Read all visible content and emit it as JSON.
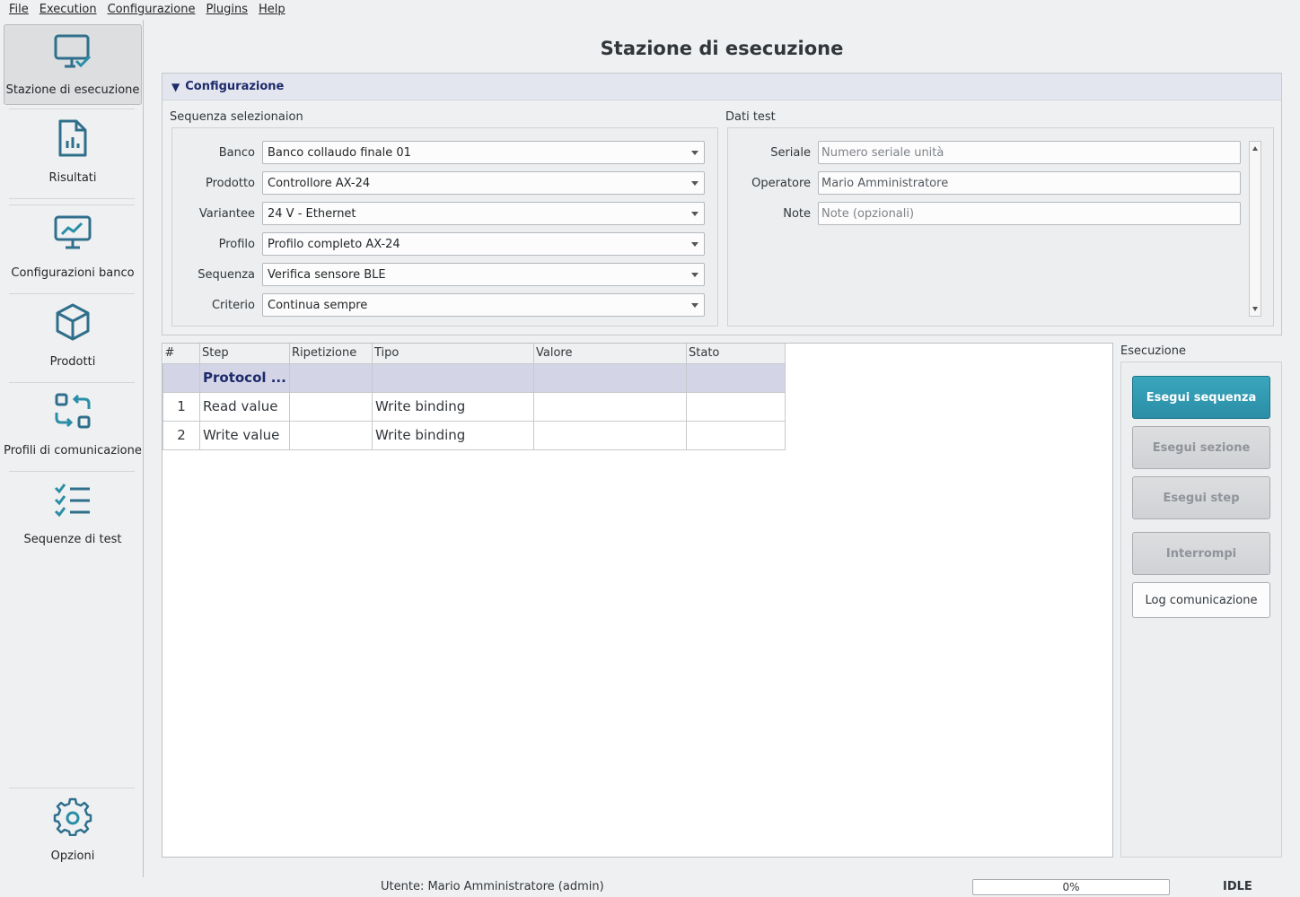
{
  "menu": [
    "File",
    "Execution",
    "Configurazione",
    "Plugins",
    "Help"
  ],
  "sidebar": {
    "items": [
      {
        "label": "Stazione di esecuzione",
        "icon": "monitor-check-icon"
      },
      {
        "label": "Risultati",
        "icon": "report-chart-icon"
      },
      {
        "label": "Configurazioni banco",
        "icon": "monitor-chart-icon"
      },
      {
        "label": "Prodotti",
        "icon": "box-icon"
      },
      {
        "label": "Profili di comunicazione",
        "icon": "exchange-icon"
      },
      {
        "label": "Sequenze di test",
        "icon": "checklist-icon"
      },
      {
        "label": "Opzioni",
        "icon": "gear-icon"
      }
    ]
  },
  "page": {
    "title": "Stazione di esecuzione"
  },
  "config": {
    "header": "Configurazione",
    "selection": {
      "title": "Sequenza selezionaion",
      "fields": [
        {
          "label": "Banco",
          "value": "Banco collaudo finale 01"
        },
        {
          "label": "Prodotto",
          "value": "Controllore AX-24"
        },
        {
          "label": "Variantee",
          "value": "24 V - Ethernet"
        },
        {
          "label": "Profilo",
          "value": "Profilo completo AX-24"
        },
        {
          "label": "Sequenza",
          "value": "Verifica sensore BLE"
        },
        {
          "label": "Criterio",
          "value": "Continua sempre"
        }
      ]
    },
    "testdata": {
      "title": "Dati test",
      "fields": [
        {
          "label": "Seriale",
          "placeholder": "Numero seriale unità"
        },
        {
          "label": "Operatore",
          "value": "Mario Amministratore"
        },
        {
          "label": "Note",
          "placeholder": "Note (opzionali)"
        }
      ]
    }
  },
  "table": {
    "columns": [
      "#",
      "Step",
      "Ripetizione",
      "Tipo",
      "Valore",
      "Stato"
    ],
    "group_row": "Protocol ...",
    "rows": [
      {
        "num": "1",
        "step": "Read value",
        "rep": "",
        "tipo": "Write binding",
        "valore": "",
        "stato": ""
      },
      {
        "num": "2",
        "step": "Write value",
        "rep": "",
        "tipo": "Write binding",
        "valore": "",
        "stato": ""
      }
    ]
  },
  "execution": {
    "title": "Esecuzione",
    "run_sequence": "Esegui sequenza",
    "run_section": "Esegui sezione",
    "run_step": "Esegui step",
    "stop": "Interrompi",
    "comm_log": "Log comunicazione"
  },
  "status": {
    "user": "Utente: Mario Amministratore (admin)",
    "progress": "0%",
    "progress_value": 0,
    "state": "IDLE"
  },
  "colors": {
    "accent": "#2a8ea6",
    "icon": "#3b7f9a",
    "group_row": "#d3d5e7"
  }
}
